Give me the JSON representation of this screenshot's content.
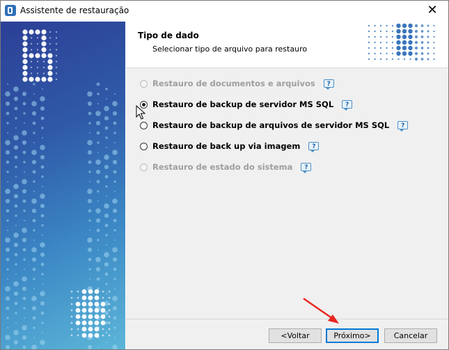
{
  "window": {
    "title": "Assistente de restauração",
    "close_glyph": "✕"
  },
  "header": {
    "title": "Tipo de dado",
    "subtitle": "Selecionar tipo de arquivo para restauro"
  },
  "options": [
    {
      "label": "Restauro de documentos e arquivos",
      "enabled": false,
      "selected": false
    },
    {
      "label": "Restauro de backup de servidor MS SQL",
      "enabled": true,
      "selected": true
    },
    {
      "label": "Restauro de backup de arquivos de servidor MS SQL",
      "enabled": true,
      "selected": false
    },
    {
      "label": "Restauro de back up via imagem",
      "enabled": true,
      "selected": false
    },
    {
      "label": "Restauro de estado do sistema",
      "enabled": false,
      "selected": false
    }
  ],
  "help_glyph": "?",
  "footer": {
    "back_label": "<Voltar",
    "next_label": "Próximo>",
    "cancel_label": "Cancelar"
  },
  "colors": {
    "sidebar_gradient_start": "#2c3f96",
    "sidebar_gradient_end": "#5cb6d8",
    "annotation_arrow": "#e8261f",
    "focus_border": "#0078d7"
  },
  "icons": [
    "app-logo-icon",
    "close-icon",
    "help-icon",
    "mouse-cursor-icon",
    "red-arrow-annotation"
  ]
}
